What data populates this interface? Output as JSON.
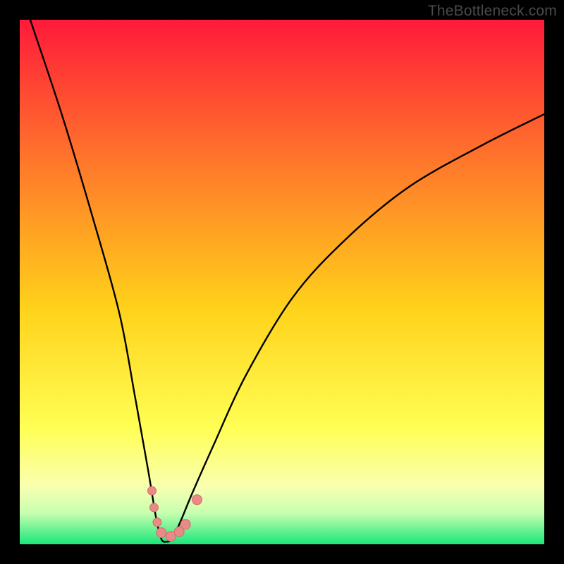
{
  "watermark": "TheBottleneck.com",
  "colors": {
    "frame": "#000000",
    "grad_top": "#ff1a3a",
    "grad_mid1": "#ff7a2a",
    "grad_mid2": "#ffd21a",
    "grad_mid3": "#ffff55",
    "grad_low1": "#f9ffb0",
    "grad_low2": "#c8ffb0",
    "grad_bottom": "#1ae67a",
    "curve": "#000000",
    "dot_fill": "#e98a88",
    "dot_stroke": "#d46b69"
  },
  "chart_data": {
    "type": "line",
    "title": "",
    "xlabel": "",
    "ylabel": "",
    "xlim": [
      0,
      100
    ],
    "ylim": [
      0,
      100
    ],
    "notch_x": 27,
    "curve_points_norm": [
      [
        2,
        100
      ],
      [
        8,
        82
      ],
      [
        14,
        62
      ],
      [
        19,
        44
      ],
      [
        22,
        28
      ],
      [
        24.5,
        14
      ],
      [
        26,
        5
      ],
      [
        27,
        1
      ],
      [
        28,
        0.5
      ],
      [
        29,
        1
      ],
      [
        30.5,
        4
      ],
      [
        33,
        10
      ],
      [
        37,
        19
      ],
      [
        43,
        32
      ],
      [
        52,
        47
      ],
      [
        62,
        58
      ],
      [
        74,
        68
      ],
      [
        88,
        76
      ],
      [
        100,
        82
      ]
    ],
    "dots_norm": [
      [
        25.2,
        10.2,
        6
      ],
      [
        25.6,
        7.0,
        6
      ],
      [
        26.2,
        4.2,
        6
      ],
      [
        27.0,
        2.2,
        7
      ],
      [
        28.8,
        1.5,
        7
      ],
      [
        30.4,
        2.4,
        7
      ],
      [
        31.6,
        3.8,
        7
      ],
      [
        33.8,
        8.5,
        7
      ]
    ]
  }
}
